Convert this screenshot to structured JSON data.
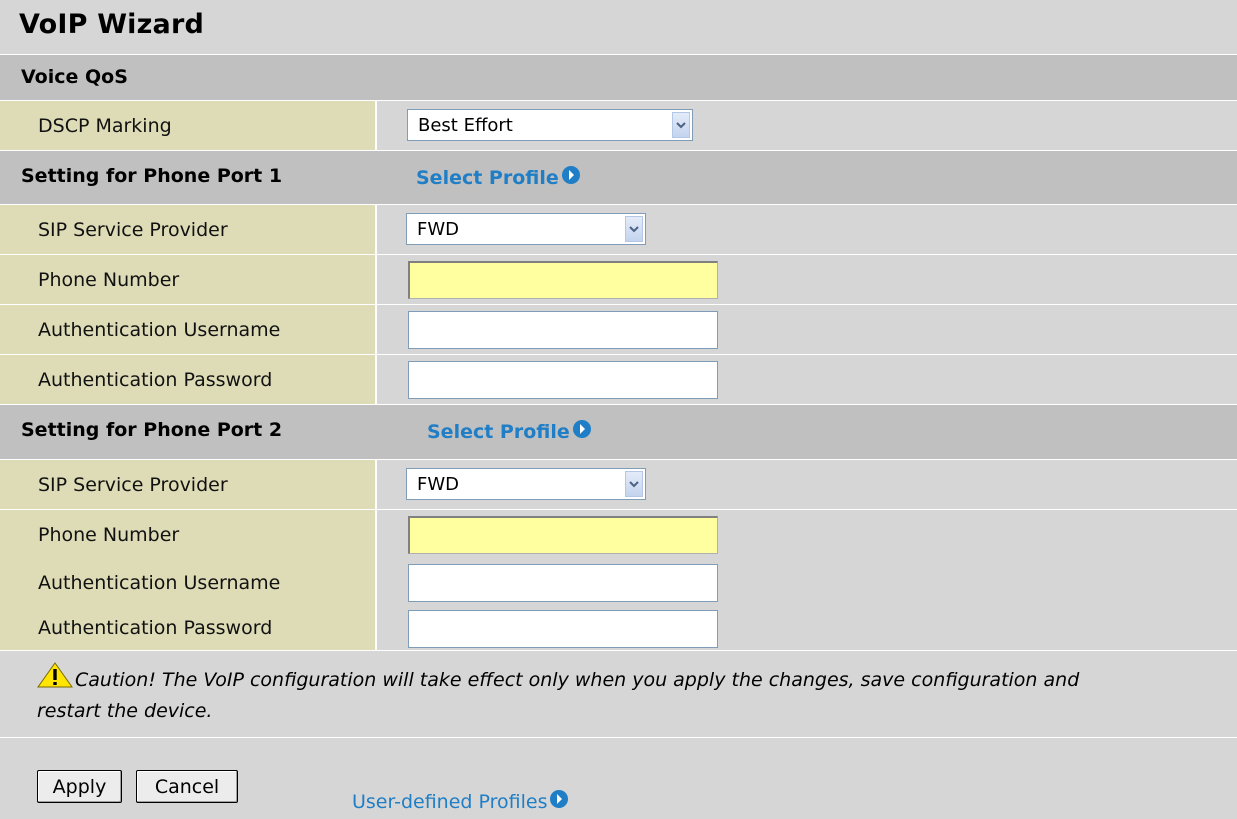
{
  "title": "VoIP Wizard",
  "voice_qos": {
    "section_label": "Voice QoS",
    "dscp_label": "DSCP Marking",
    "dscp_value": "Best Effort"
  },
  "port1": {
    "section_label": "Setting for Phone Port 1",
    "profile_link": "Select Profile",
    "sip_label": "SIP Service Provider",
    "sip_value": "FWD",
    "phone_label": "Phone Number",
    "phone_value": "",
    "user_label": "Authentication Username",
    "user_value": "",
    "pass_label": "Authentication Password",
    "pass_value": ""
  },
  "port2": {
    "section_label": "Setting for Phone Port 2",
    "profile_link": "Select Profile",
    "sip_label": "SIP Service Provider",
    "sip_value": "FWD",
    "phone_label": "Phone Number",
    "phone_value": "",
    "user_label": "Authentication Username",
    "user_value": "",
    "pass_label": "Authentication Password",
    "pass_value": ""
  },
  "caution": {
    "icon": "warning-icon",
    "text": "Caution! The VoIP configuration will take effect only when you apply the changes, save configuration and restart the device."
  },
  "buttons": {
    "apply": "Apply",
    "cancel": "Cancel"
  },
  "user_profiles_link": "User-defined Profiles",
  "colors": {
    "link": "#1f7ec5",
    "label_bg": "#dedcb6",
    "section_bg": "#c0c0c0",
    "required_field_bg": "#ffff9f"
  }
}
